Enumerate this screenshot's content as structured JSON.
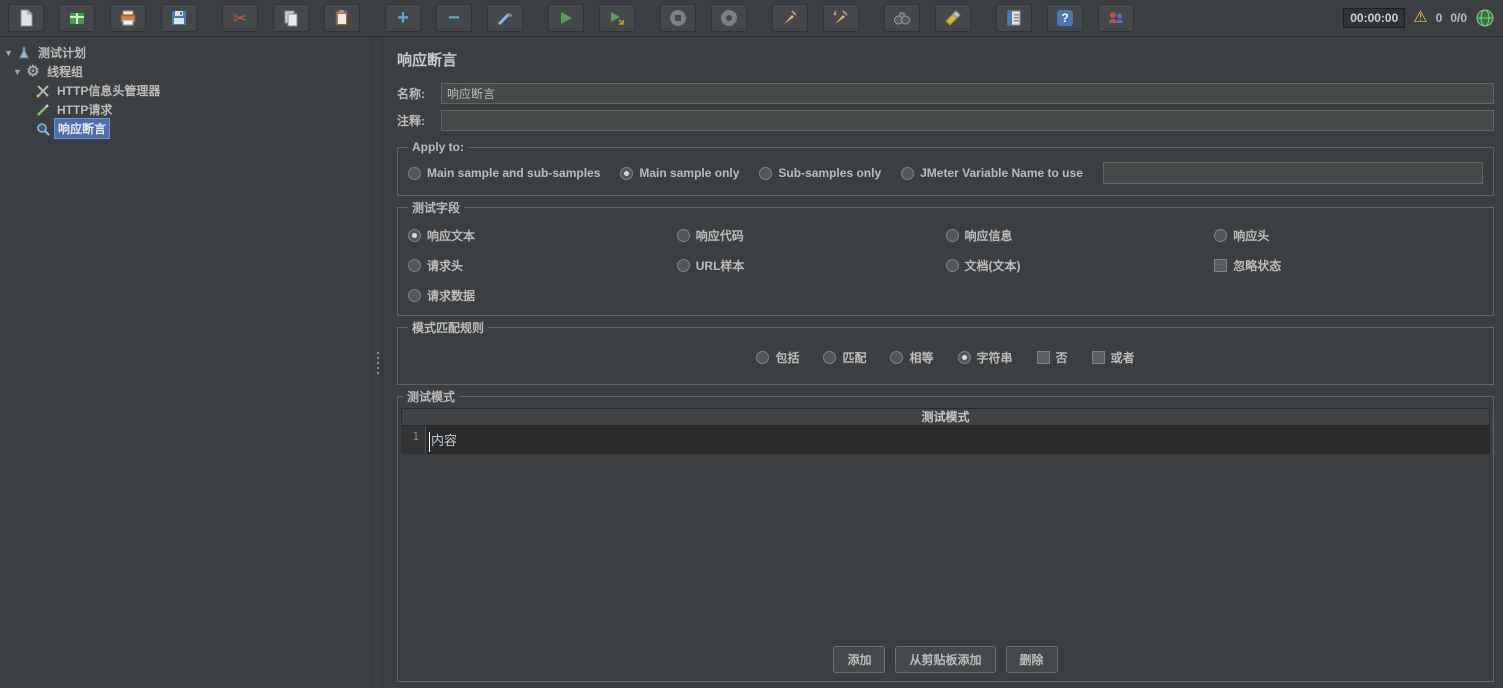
{
  "toolbar": {
    "timer": "00:00:00",
    "error_count": "0",
    "threads": "0/0"
  },
  "glyphs": {
    "triangle_down": "▼",
    "gear": "⚙",
    "scissors": "✂",
    "plus": "+",
    "minus": "−",
    "play": "▶",
    "warning": "⚠",
    "question": "?"
  },
  "tree": {
    "items": [
      {
        "label": "测试计划"
      },
      {
        "label": "线程组"
      },
      {
        "label": "HTTP信息头管理器"
      },
      {
        "label": "HTTP请求"
      },
      {
        "label": "响应断言"
      }
    ]
  },
  "main": {
    "title": "响应断言",
    "name": {
      "label": "名称:",
      "value": "响应断言"
    },
    "comments": {
      "label": "注释:",
      "value": ""
    },
    "apply_to": {
      "legend": "Apply to:",
      "options": [
        {
          "label": "Main sample and sub-samples",
          "selected": false
        },
        {
          "label": "Main sample only",
          "selected": true
        },
        {
          "label": "Sub-samples only",
          "selected": false
        },
        {
          "label": "JMeter Variable Name to use",
          "selected": false
        }
      ],
      "variable_value": ""
    },
    "test_field": {
      "legend": "测试字段",
      "options": [
        {
          "label": "响应文本",
          "selected": true
        },
        {
          "label": "响应代码",
          "selected": false
        },
        {
          "label": "响应信息",
          "selected": false
        },
        {
          "label": "响应头",
          "selected": false
        },
        {
          "label": "请求头",
          "selected": false
        },
        {
          "label": "URL样本",
          "selected": false
        },
        {
          "label": "文档(文本)",
          "selected": false
        },
        {
          "label": "请求数据",
          "selected": false
        }
      ],
      "ignore_status": {
        "label": "忽略状态",
        "checked": false
      }
    },
    "pattern_rules": {
      "legend": "模式匹配规则",
      "options": [
        {
          "label": "包括",
          "selected": false
        },
        {
          "label": "匹配",
          "selected": false
        },
        {
          "label": "相等",
          "selected": false
        },
        {
          "label": "字符串",
          "selected": true
        }
      ],
      "not_checkbox": {
        "label": "否",
        "checked": false
      },
      "or_checkbox": {
        "label": "或者",
        "checked": false
      }
    },
    "patterns": {
      "legend": "测试模式",
      "header": "测试模式",
      "rows": [
        {
          "line": "1",
          "value": "内容"
        }
      ],
      "buttons": {
        "add": "添加",
        "add_from_clipboard": "从剪贴板添加",
        "delete": "删除"
      }
    }
  }
}
